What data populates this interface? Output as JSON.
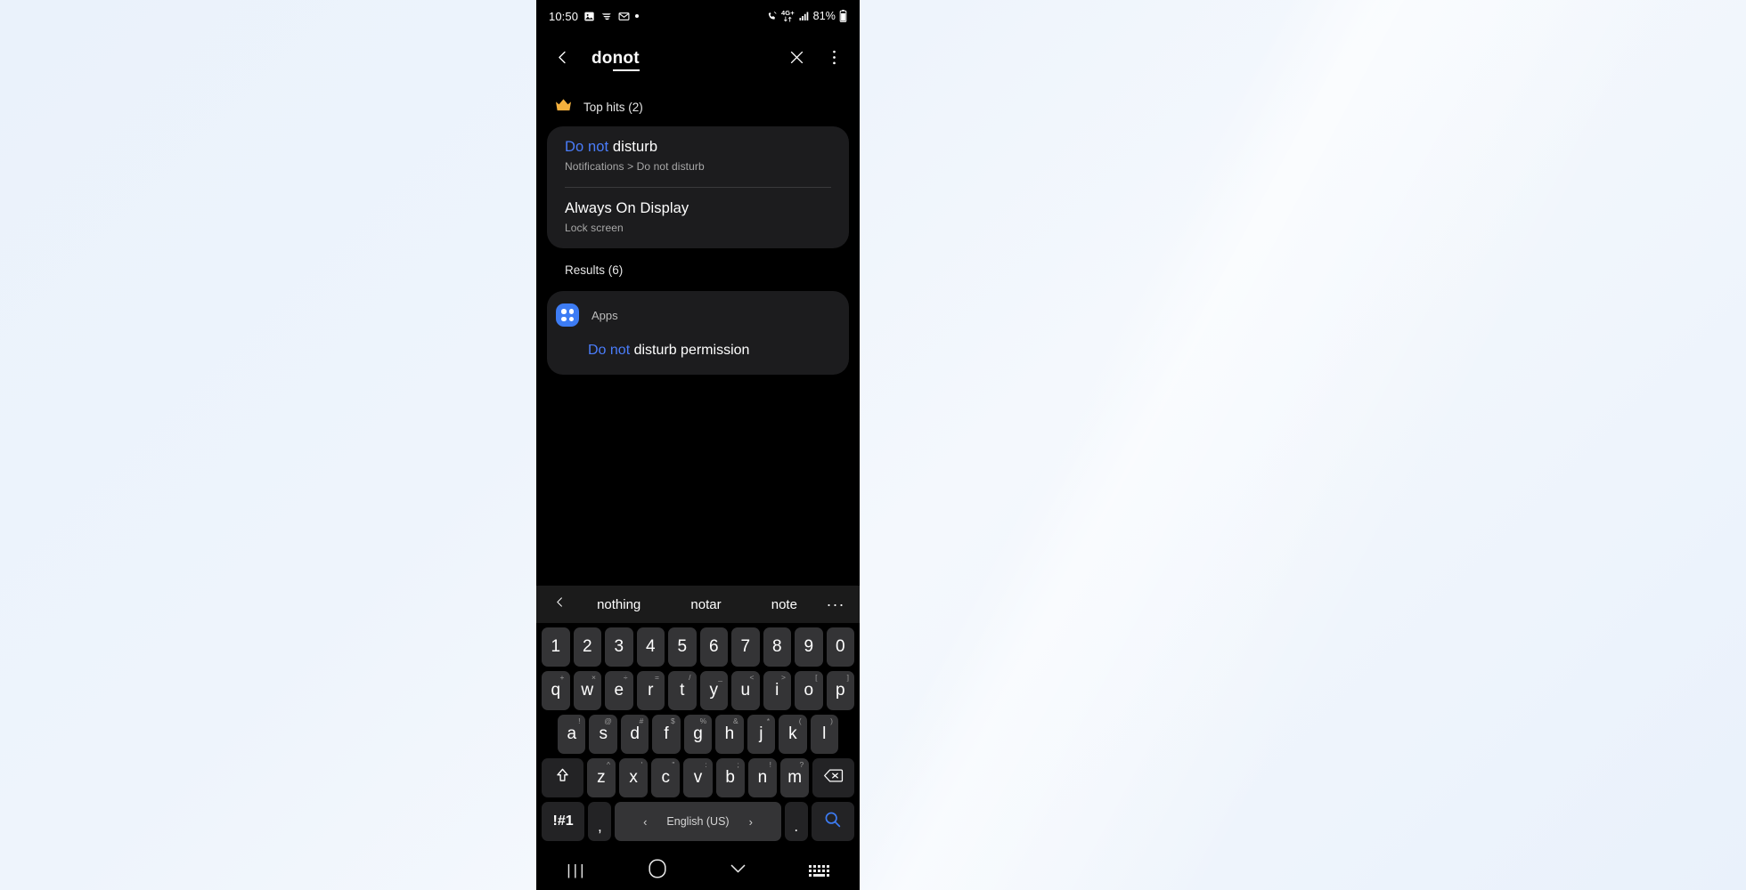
{
  "statusbar": {
    "time": "10:50",
    "left_icons": [
      "photo-icon",
      "wifi-calling-icon",
      "mail-icon",
      "dot-indicator-icon"
    ],
    "network_label": "4G+",
    "battery_percent": "81%",
    "right_icons": [
      "call-icon",
      "network-4gplus-icon",
      "signal-bars-icon",
      "battery-icon"
    ]
  },
  "searchbar": {
    "back_icon": "chevron-left-icon",
    "query_plain": "do ",
    "query_selected": "not",
    "clear_icon": "close-icon",
    "menu_icon": "more-vertical-icon"
  },
  "tophits": {
    "icon": "crown-icon",
    "label": "Top hits (2)",
    "items": [
      {
        "title_highlight": "Do not",
        "title_rest": " disturb",
        "subtitle": "Notifications > Do not disturb"
      },
      {
        "title_highlight": "",
        "title_rest": "Always On Display",
        "subtitle": "Lock screen"
      }
    ]
  },
  "results": {
    "label": "Results (6)",
    "group": {
      "icon": "apps-grid-icon",
      "label": "Apps",
      "items": [
        {
          "title_highlight": "Do not",
          "title_rest": " disturb permission"
        }
      ]
    }
  },
  "keyboard": {
    "suggestions": {
      "prev_icon": "chevron-left-icon",
      "words": [
        "nothing",
        "notar",
        "note"
      ],
      "more_icon": "more-horizontal-icon"
    },
    "rows": [
      {
        "keys": [
          {
            "label": "1"
          },
          {
            "label": "2"
          },
          {
            "label": "3"
          },
          {
            "label": "4"
          },
          {
            "label": "5"
          },
          {
            "label": "6"
          },
          {
            "label": "7"
          },
          {
            "label": "8"
          },
          {
            "label": "9"
          },
          {
            "label": "0"
          }
        ]
      },
      {
        "keys": [
          {
            "label": "q",
            "sup": "+"
          },
          {
            "label": "w",
            "sup": "×"
          },
          {
            "label": "e",
            "sup": "÷"
          },
          {
            "label": "r",
            "sup": "="
          },
          {
            "label": "t",
            "sup": "/"
          },
          {
            "label": "y",
            "sup": "_"
          },
          {
            "label": "u",
            "sup": "<"
          },
          {
            "label": "i",
            "sup": ">"
          },
          {
            "label": "o",
            "sup": "["
          },
          {
            "label": "p",
            "sup": "]"
          }
        ]
      },
      {
        "keys": [
          {
            "label": "a",
            "sup": "!"
          },
          {
            "label": "s",
            "sup": "@"
          },
          {
            "label": "d",
            "sup": "#"
          },
          {
            "label": "f",
            "sup": "$"
          },
          {
            "label": "g",
            "sup": "%"
          },
          {
            "label": "h",
            "sup": "&"
          },
          {
            "label": "j",
            "sup": "*"
          },
          {
            "label": "k",
            "sup": "("
          },
          {
            "label": "l",
            "sup": ")"
          }
        ]
      },
      {
        "keys": [
          {
            "label": "z",
            "sup": "^"
          },
          {
            "label": "x",
            "sup": "'"
          },
          {
            "label": "c",
            "sup": "\""
          },
          {
            "label": "v",
            "sup": ":"
          },
          {
            "label": "b",
            "sup": ";"
          },
          {
            "label": "n",
            "sup": "!"
          },
          {
            "label": "m",
            "sup": "?"
          }
        ]
      }
    ],
    "shift_icon": "shift-up-icon",
    "backspace_icon": "backspace-icon",
    "symbols_label": "!#1",
    "comma_label": ",",
    "period_label": ".",
    "language_label": "English (US)",
    "lang_prev_icon": "chevron-left-icon",
    "lang_next_icon": "chevron-right-icon",
    "search_icon": "search-icon",
    "accent": "#3d7cf4"
  },
  "navbar": {
    "recents_label": "|||",
    "home_icon": "home-squircle-icon",
    "hide_keyboard_icon": "chevron-down-icon",
    "keyboard_switch_icon": "keyboard-icon"
  }
}
